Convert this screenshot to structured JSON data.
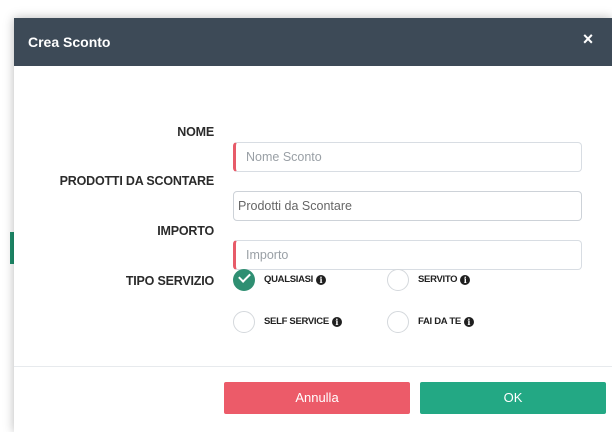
{
  "dialog": {
    "title": "Crea Sconto",
    "close_icon": "close-icon",
    "close_label": "×"
  },
  "form": {
    "nome": {
      "label": "NOME",
      "placeholder": "Nome Sconto",
      "value": ""
    },
    "prodotti": {
      "label": "PRODOTTI DA SCONTARE",
      "value": "Prodotti da Scontare",
      "placeholder": ""
    },
    "importo": {
      "label": "IMPORTO",
      "placeholder": "Importo",
      "value": ""
    },
    "tipo_servizio": {
      "label": "TIPO SERVIZIO",
      "options": [
        {
          "label": "QUALSIASI",
          "selected": true,
          "info_icon": "info-icon"
        },
        {
          "label": "SERVITO",
          "selected": false,
          "info_icon": "info-icon"
        },
        {
          "label": "SELF SERVICE",
          "selected": false,
          "info_icon": "info-icon"
        },
        {
          "label": "FAI DA TE",
          "selected": false,
          "info_icon": "info-icon"
        }
      ],
      "selected_value": "QUALSIASI"
    }
  },
  "footer": {
    "cancel_label": "Annulla",
    "ok_label": "OK"
  },
  "colors": {
    "header": "#3d4a57",
    "required_marker": "#e75b69",
    "selected_radio": "#2f8f72",
    "cancel_button": "#ec5b69",
    "ok_button": "#23a884"
  },
  "icons": {
    "checked_icon": "check-icon",
    "info_icon": "info-icon",
    "close_icon": "close-icon"
  }
}
